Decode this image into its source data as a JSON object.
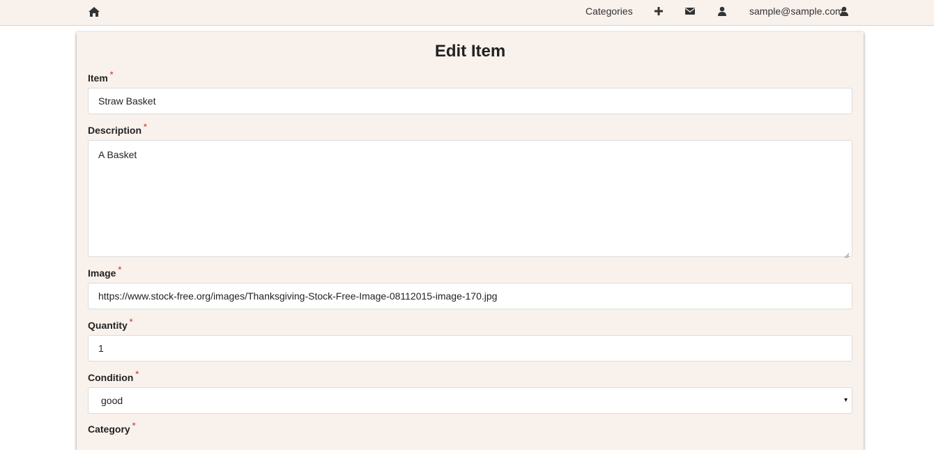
{
  "navbar": {
    "home_icon": "home-icon",
    "categories_label": "Categories",
    "add_icon": "plus-icon",
    "mail_icon": "envelope-icon",
    "user_icon": "user-icon",
    "account_email": "sample@sample.com",
    "account_icon": "user-icon"
  },
  "form": {
    "title": "Edit Item",
    "required_marker": "*",
    "item": {
      "label": "Item",
      "value": "Straw Basket"
    },
    "description": {
      "label": "Description",
      "value": "A Basket"
    },
    "image": {
      "label": "Image",
      "value": "https://www.stock-free.org/images/Thanksgiving-Stock-Free-Image-08112015-image-170.jpg"
    },
    "quantity": {
      "label": "Quantity",
      "value": "1"
    },
    "condition": {
      "label": "Condition",
      "value": "good",
      "arrow_glyph": "▾"
    },
    "category": {
      "label": "Category"
    }
  },
  "colors": {
    "navbar_bg": "#f9f1ec",
    "card_bg": "#f9f1ec",
    "required": "#d9534f"
  }
}
